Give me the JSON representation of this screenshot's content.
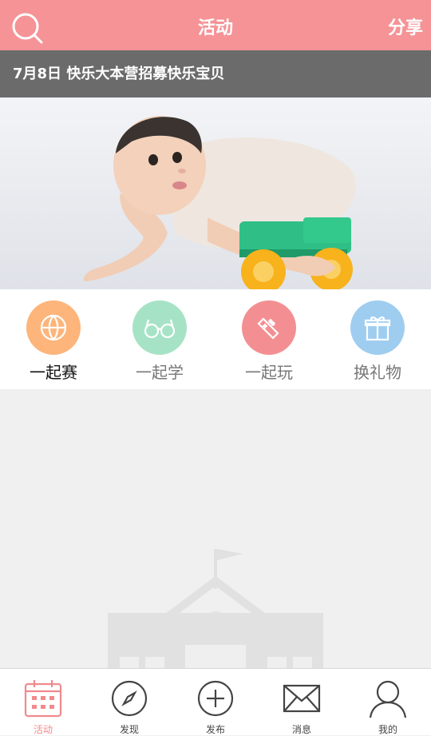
{
  "header": {
    "title": "活动",
    "share_label": "分享"
  },
  "banner": {
    "caption": "7月8日 快乐大本营招募快乐宝贝"
  },
  "categories": [
    {
      "label": "一起赛",
      "icon": "basketball-icon",
      "color": "#fdb57b",
      "active": true
    },
    {
      "label": "一起学",
      "icon": "glasses-icon",
      "color": "#a6e3c6",
      "active": false
    },
    {
      "label": "一起玩",
      "icon": "gamepad-icon",
      "color": "#f38f92",
      "active": false
    },
    {
      "label": "换礼物",
      "icon": "gift-icon",
      "color": "#9ecdf0",
      "active": false
    }
  ],
  "nav": [
    {
      "label": "活动",
      "icon": "calendar-icon",
      "active": true
    },
    {
      "label": "发现",
      "icon": "compass-icon",
      "active": false
    },
    {
      "label": "发布",
      "icon": "plus-circle-icon",
      "active": false
    },
    {
      "label": "消息",
      "icon": "envelope-icon",
      "active": false
    },
    {
      "label": "我的",
      "icon": "user-icon",
      "active": false
    }
  ],
  "colors": {
    "brand": "#f59396",
    "active_nav": "#f08a8d"
  }
}
